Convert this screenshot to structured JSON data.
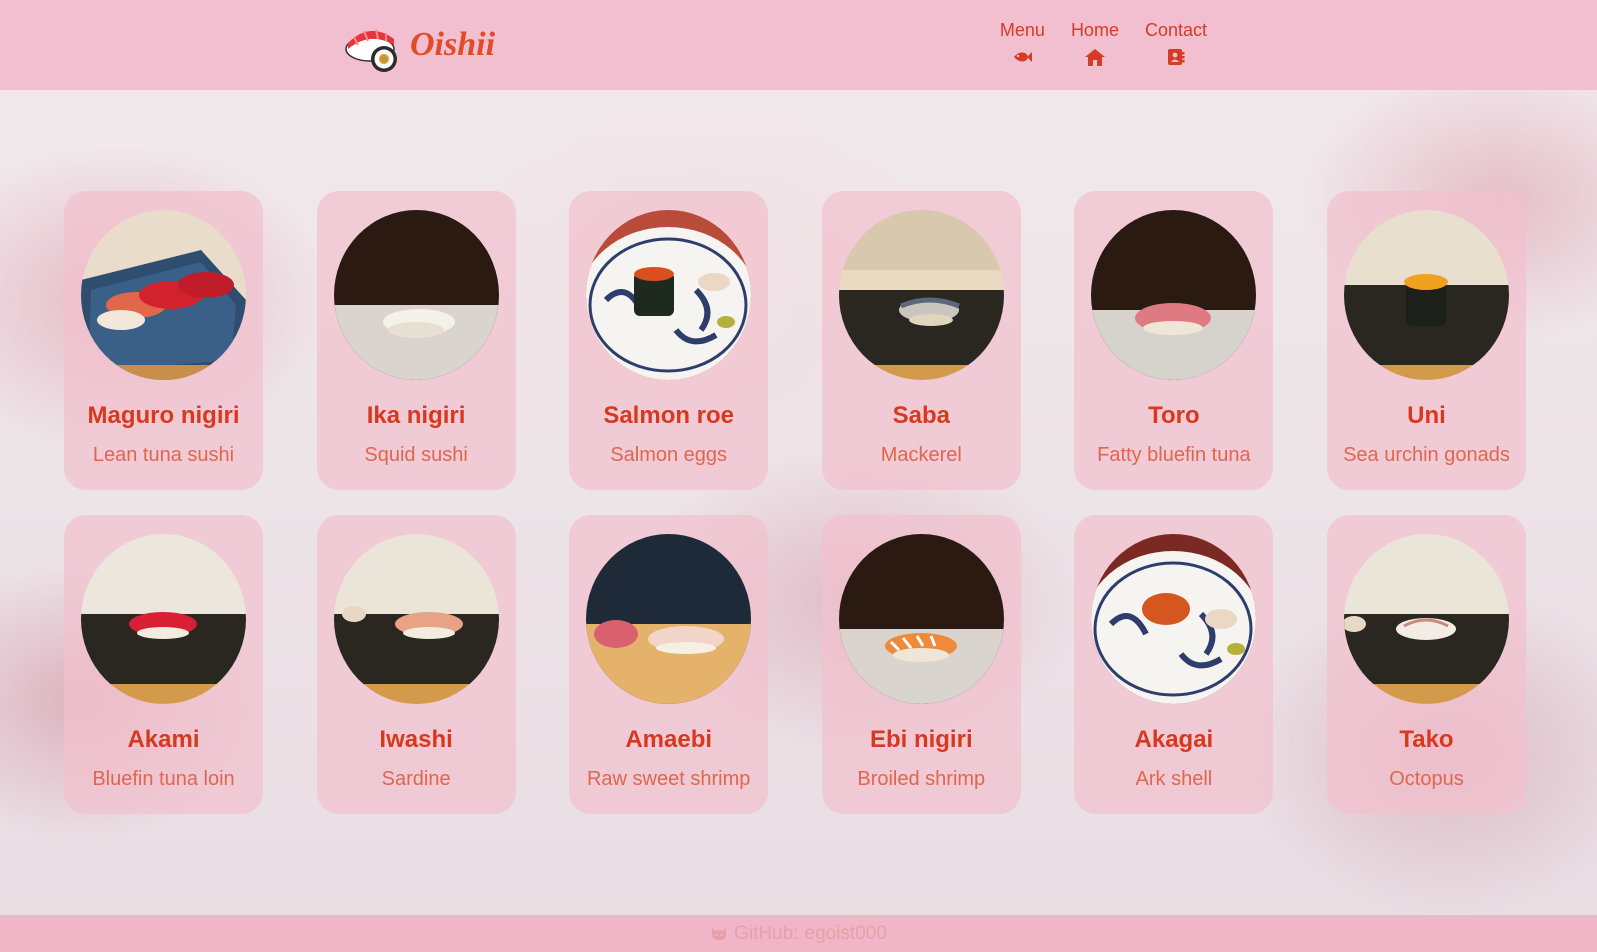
{
  "brand": {
    "name": "Oishii"
  },
  "nav": [
    {
      "label": "Menu",
      "icon": "fish-icon"
    },
    {
      "label": "Home",
      "icon": "home-icon"
    },
    {
      "label": "Contact",
      "icon": "contact-book-icon"
    }
  ],
  "colors": {
    "header_bg": "#f1bfcf",
    "accent": "#d8391e",
    "subtitle": "#e0664d",
    "card_bg": "#f1c0cd",
    "footer_bg": "#f1b5c8"
  },
  "menu": [
    {
      "title": "Maguro nigiri",
      "subtitle": "Lean tuna sushi"
    },
    {
      "title": "Ika nigiri",
      "subtitle": "Squid sushi"
    },
    {
      "title": "Salmon roe",
      "subtitle": "Salmon eggs"
    },
    {
      "title": "Saba",
      "subtitle": "Mackerel"
    },
    {
      "title": "Toro",
      "subtitle": "Fatty bluefin tuna"
    },
    {
      "title": "Uni",
      "subtitle": "Sea urchin gonads"
    },
    {
      "title": "Akami",
      "subtitle": "Bluefin tuna loin"
    },
    {
      "title": "Iwashi",
      "subtitle": "Sardine"
    },
    {
      "title": "Amaebi",
      "subtitle": "Raw sweet shrimp"
    },
    {
      "title": "Ebi nigiri",
      "subtitle": "Broiled shrimp"
    },
    {
      "title": "Akagai",
      "subtitle": "Ark shell"
    },
    {
      "title": "Tako",
      "subtitle": "Octopus"
    }
  ],
  "footer": {
    "label": "GitHub:",
    "username": "egoist000",
    "icon": "github-icon"
  }
}
